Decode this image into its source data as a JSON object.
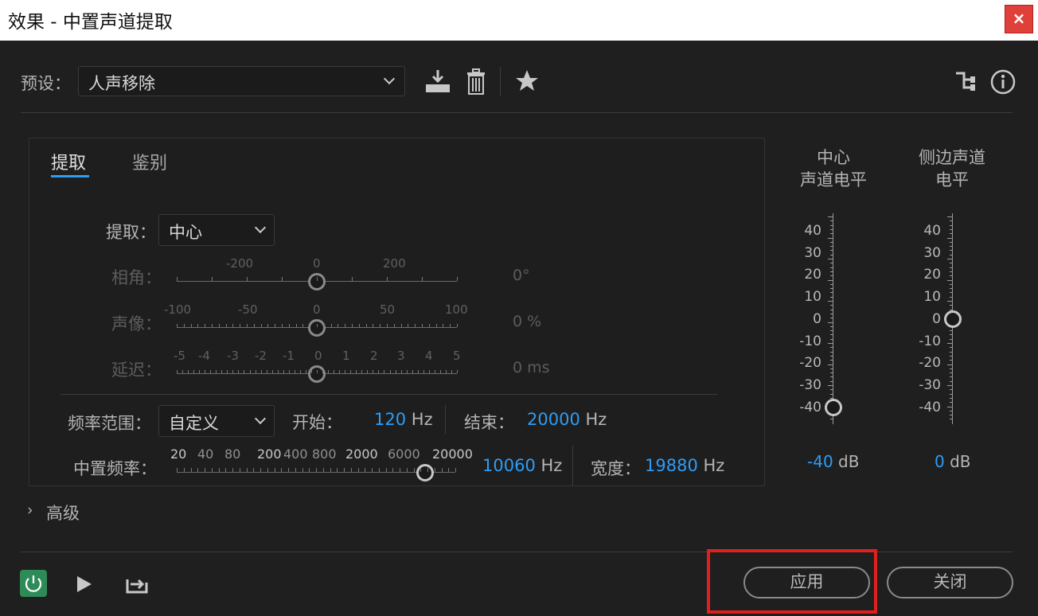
{
  "window": {
    "title": "效果 - 中置声道提取",
    "close_glyph": "×"
  },
  "preset": {
    "label": "预设：",
    "value": "人声移除"
  },
  "tabs": [
    {
      "label": "提取",
      "active": true
    },
    {
      "label": "鉴别",
      "active": false
    }
  ],
  "extract": {
    "label": "提取：",
    "value": "中心"
  },
  "sliders": {
    "phase": {
      "label": "相角：",
      "ticks": [
        "-200",
        "0",
        "200"
      ],
      "value": "0°"
    },
    "pan": {
      "label": "声像：",
      "ticks": [
        "-100",
        "-50",
        "0",
        "50",
        "100"
      ],
      "value": "0 %"
    },
    "delay": {
      "label": "延迟：",
      "ticks": [
        "-5",
        "-4",
        "-3",
        "-2",
        "-1",
        "0",
        "1",
        "2",
        "3",
        "4",
        "5"
      ],
      "value": "0 ms"
    }
  },
  "freq_range": {
    "label": "频率范围：",
    "value": "自定义",
    "start_label": "开始：",
    "start_value": "120",
    "start_unit": "Hz",
    "end_label": "结束：",
    "end_value": "20000",
    "end_unit": "Hz"
  },
  "center_freq": {
    "label": "中置频率：",
    "ticks": [
      "20",
      "40",
      "80",
      "200",
      "400",
      "800",
      "2000",
      "6000",
      "20000"
    ],
    "value": "10060",
    "unit": "Hz",
    "width_label": "宽度：",
    "width_value": "19880",
    "width_unit": "Hz"
  },
  "meters": {
    "center": {
      "title_line1": "中心",
      "title_line2": "声道电平",
      "value": "-40",
      "unit": "dB",
      "level": -40
    },
    "side": {
      "title_line1": "侧边声道",
      "title_line2": "电平",
      "value": "0",
      "unit": "dB",
      "level": 0
    },
    "scale": [
      "40",
      "30",
      "20",
      "10",
      "0",
      "-10",
      "-20",
      "-30",
      "-40"
    ]
  },
  "advanced": {
    "label": "高级"
  },
  "buttons": {
    "apply": "应用",
    "close": "关闭"
  },
  "colors": {
    "accent": "#2f9cf5",
    "power": "#2e8b57",
    "highlight": "#e0201e"
  }
}
